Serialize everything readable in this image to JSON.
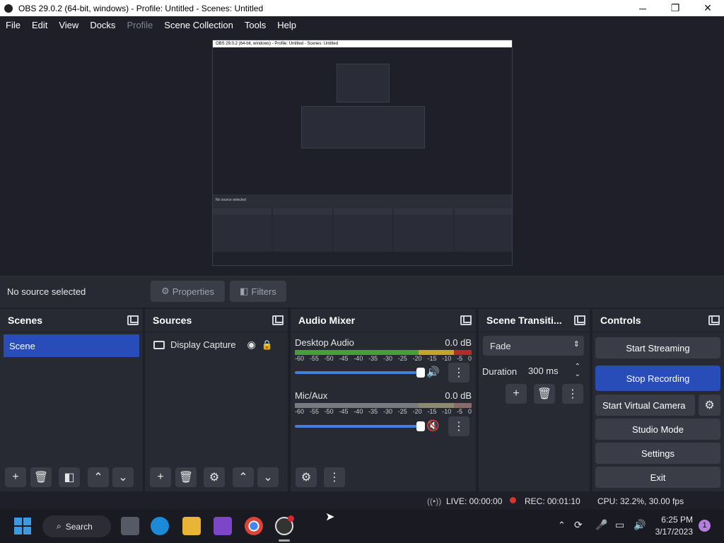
{
  "titlebar": {
    "title": "OBS 29.0.2 (64-bit, windows) - Profile: Untitled - Scenes: Untitled",
    "minimize": "─",
    "maximize": "❐",
    "close": "✕"
  },
  "menu": [
    "File",
    "Edit",
    "View",
    "Docks",
    "Profile",
    "Scene Collection",
    "Tools",
    "Help"
  ],
  "menu_disabled": [
    "Profile"
  ],
  "inner_preview": {
    "title": "OBS 29.0.2 (64-bit, windows) - Profile: Untitled - Scenes: Untitled",
    "nosource": "No source selected"
  },
  "props": {
    "nosource": "No source selected",
    "properties": "Properties",
    "filters": "Filters"
  },
  "scenes": {
    "title": "Scenes",
    "items": [
      "Scene"
    ]
  },
  "sources": {
    "title": "Sources",
    "items": [
      "Display Capture"
    ]
  },
  "mixer": {
    "title": "Audio Mixer",
    "channels": [
      {
        "name": "Desktop Audio",
        "db": "0.0 dB"
      },
      {
        "name": "Mic/Aux",
        "db": "0.0 dB"
      }
    ],
    "ticks": [
      "-60",
      "-55",
      "-50",
      "-45",
      "-40",
      "-35",
      "-30",
      "-25",
      "-20",
      "-15",
      "-10",
      "-5",
      "0"
    ]
  },
  "transitions": {
    "title": "Scene Transiti...",
    "selected": "Fade",
    "duration_label": "Duration",
    "duration": "300 ms"
  },
  "controls": {
    "title": "Controls",
    "start_streaming": "Start Streaming",
    "stop_recording": "Stop Recording",
    "start_virtual": "Start Virtual Camera",
    "studio_mode": "Studio Mode",
    "settings": "Settings",
    "exit": "Exit"
  },
  "status": {
    "live": "LIVE: 00:00:00",
    "rec": "REC: 00:01:10",
    "cpu": "CPU: 32.2%, 30.00 fps"
  },
  "taskbar": {
    "search": "Search",
    "time": "6:25 PM",
    "date": "3/17/2023",
    "notif": "1"
  },
  "colors": {
    "accent": "#284cb8",
    "rec": "#d9342b"
  }
}
